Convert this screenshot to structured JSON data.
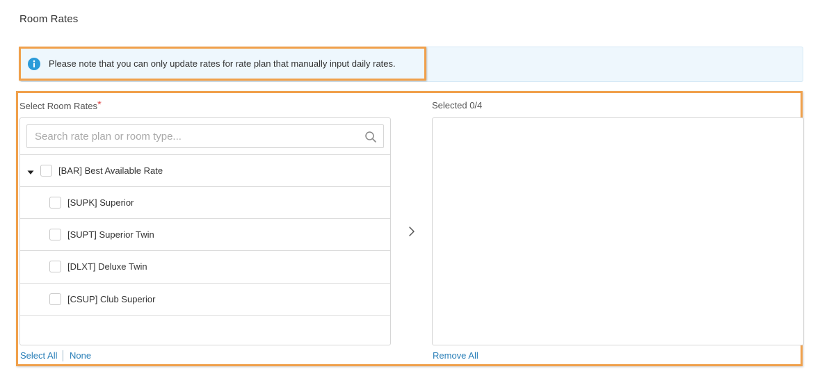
{
  "page": {
    "title": "Room Rates"
  },
  "notice": {
    "icon": "info-icon",
    "text": "Please note that you can only update rates for rate plan that manually input daily rates."
  },
  "select_panel": {
    "label": "Select Room Rates",
    "required_marker": "*",
    "search_placeholder": "Search rate plan or room type...",
    "search_value": "",
    "parent": {
      "label": "[BAR] Best Available Rate",
      "expanded": true,
      "checked": false
    },
    "children": [
      {
        "label": "[SUPK] Superior",
        "checked": false
      },
      {
        "label": "[SUPT] Superior Twin",
        "checked": false
      },
      {
        "label": "[DLXT] Deluxe Twin",
        "checked": false
      },
      {
        "label": "[CSUP] Club Superior",
        "checked": false
      }
    ],
    "select_all_label": "Select All",
    "none_label": "None"
  },
  "selected_panel": {
    "label": "Selected 0/4",
    "remove_all_label": "Remove All"
  },
  "colors": {
    "accent_link": "#2a7fb8",
    "info_icon": "#2b9bd9",
    "highlight": "#f0a04b",
    "notice_bg": "#eef7fd",
    "required": "#e04b4b"
  }
}
